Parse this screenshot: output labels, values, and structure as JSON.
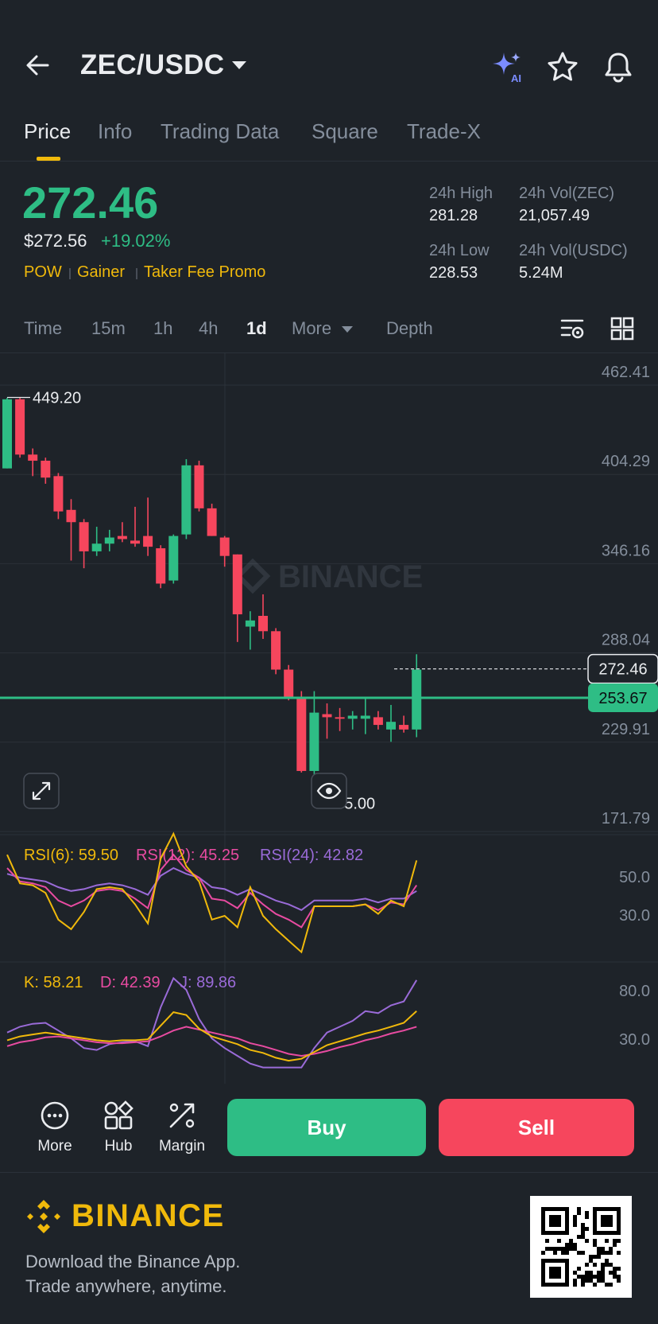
{
  "header": {
    "pair": "ZEC/USDC",
    "icons": [
      "back-arrow-icon",
      "chevron-down-icon",
      "ai-sparkle-icon",
      "star-icon",
      "bell-icon"
    ],
    "ai_label": "AI"
  },
  "tabs": [
    {
      "label": "Price",
      "active": true
    },
    {
      "label": "Info",
      "active": false
    },
    {
      "label": "Trading Data",
      "active": false
    },
    {
      "label": "Square",
      "active": false
    },
    {
      "label": "Trade-X",
      "active": false
    }
  ],
  "price": {
    "last": "272.46",
    "usd": "$272.56",
    "change": "+19.02%",
    "tags": [
      "POW",
      "Gainer",
      "Taker Fee Promo"
    ]
  },
  "stats": [
    {
      "label": "24h High",
      "value": "281.28"
    },
    {
      "label": "24h Vol(ZEC)",
      "value": "21,057.49"
    },
    {
      "label": "24h Low",
      "value": "228.53"
    },
    {
      "label": "24h Vol(USDC)",
      "value": "5.24M"
    }
  ],
  "intervals": [
    {
      "label": "Time",
      "active": false
    },
    {
      "label": "15m",
      "active": false
    },
    {
      "label": "1h",
      "active": false
    },
    {
      "label": "4h",
      "active": false
    },
    {
      "label": "1d",
      "active": true
    },
    {
      "label": "More",
      "active": false
    },
    {
      "label": "Depth",
      "active": false
    }
  ],
  "chart_tools": [
    "chart-settings-icon",
    "grid-layout-icon"
  ],
  "chart_data": {
    "type": "candlestick",
    "y_ticks": [
      "462.41",
      "404.29",
      "346.16",
      "288.04",
      "229.91",
      "171.79"
    ],
    "ylim": [
      171.79,
      462.41
    ],
    "high_marker": "449.20",
    "low_marker": "185.00",
    "last_price_tag": "272.46",
    "line_price_tag": "253.67",
    "line_price": 253.67,
    "watermark": "BINANCE",
    "colors": {
      "up": "#2ebd85",
      "down": "#f6465d"
    },
    "candles": [
      {
        "o": 403,
        "h": 449,
        "l": 403,
        "c": 448
      },
      {
        "o": 448,
        "h": 449,
        "l": 410,
        "c": 412
      },
      {
        "o": 412,
        "h": 416,
        "l": 398,
        "c": 408
      },
      {
        "o": 408,
        "h": 410,
        "l": 393,
        "c": 397
      },
      {
        "o": 398,
        "h": 400,
        "l": 370,
        "c": 375
      },
      {
        "o": 376,
        "h": 383,
        "l": 343,
        "c": 368
      },
      {
        "o": 368,
        "h": 370,
        "l": 338,
        "c": 349
      },
      {
        "o": 349,
        "h": 365,
        "l": 346,
        "c": 354
      },
      {
        "o": 354,
        "h": 363,
        "l": 349,
        "c": 358
      },
      {
        "o": 359,
        "h": 368,
        "l": 355,
        "c": 357
      },
      {
        "o": 356,
        "h": 378,
        "l": 352,
        "c": 354
      },
      {
        "o": 359,
        "h": 384,
        "l": 346,
        "c": 352
      },
      {
        "o": 351,
        "h": 353,
        "l": 325,
        "c": 328
      },
      {
        "o": 330,
        "h": 360,
        "l": 328,
        "c": 359
      },
      {
        "o": 360,
        "h": 409,
        "l": 357,
        "c": 405
      },
      {
        "o": 405,
        "h": 408,
        "l": 375,
        "c": 377
      },
      {
        "o": 377,
        "h": 380,
        "l": 359,
        "c": 359
      },
      {
        "o": 358,
        "h": 359,
        "l": 339,
        "c": 346
      },
      {
        "o": 347,
        "h": 347,
        "l": 290,
        "c": 308
      },
      {
        "o": 300,
        "h": 310,
        "l": 285,
        "c": 304
      },
      {
        "o": 307,
        "h": 321,
        "l": 292,
        "c": 297
      },
      {
        "o": 297,
        "h": 299,
        "l": 269,
        "c": 272
      },
      {
        "o": 272,
        "h": 275,
        "l": 252,
        "c": 254
      },
      {
        "o": 253,
        "h": 258,
        "l": 205,
        "c": 206
      },
      {
        "o": 206,
        "h": 258,
        "l": 185,
        "c": 244
      },
      {
        "o": 243,
        "h": 250,
        "l": 227,
        "c": 241
      },
      {
        "o": 241,
        "h": 247,
        "l": 232,
        "c": 240
      },
      {
        "o": 240,
        "h": 245,
        "l": 233,
        "c": 242
      },
      {
        "o": 240,
        "h": 253,
        "l": 230,
        "c": 242
      },
      {
        "o": 241,
        "h": 245,
        "l": 233,
        "c": 236
      },
      {
        "o": 233,
        "h": 249,
        "l": 225,
        "c": 238
      },
      {
        "o": 236,
        "h": 242,
        "l": 231,
        "c": 233
      },
      {
        "o": 233,
        "h": 282,
        "l": 228,
        "c": 272
      }
    ]
  },
  "rsi": {
    "labels": [
      "RSI(6): 59.50",
      "RSI(12): 45.25",
      "RSI(24): 42.82"
    ],
    "colors": [
      "#f0b90b",
      "#e84ba1",
      "#9a6bd8"
    ],
    "ticks": [
      "50.0",
      "30.0"
    ],
    "rsi6": [
      62,
      47,
      46,
      42,
      28,
      23,
      32,
      44,
      45,
      44,
      36,
      26,
      60,
      73,
      56,
      48,
      28,
      30,
      24,
      45,
      30,
      23,
      17,
      11,
      35,
      35,
      35,
      35,
      36,
      31,
      38,
      35,
      59
    ],
    "rsi12": [
      55,
      48,
      47,
      45,
      38,
      35,
      38,
      43,
      44,
      43,
      39,
      34,
      54,
      62,
      54,
      50,
      39,
      38,
      34,
      42,
      36,
      31,
      28,
      24,
      35,
      35,
      35,
      35,
      36,
      33,
      37,
      36,
      46
    ],
    "rsi24": [
      52,
      50,
      49,
      48,
      45,
      43,
      44,
      46,
      47,
      46,
      44,
      41,
      51,
      55,
      52,
      50,
      45,
      44,
      41,
      44,
      41,
      38,
      36,
      33,
      38,
      38,
      38,
      38,
      39,
      37,
      39,
      39,
      43
    ]
  },
  "kdj": {
    "labels": [
      "K: 58.21",
      "D: 42.39",
      "J: 89.86"
    ],
    "colors": [
      "#f0b90b",
      "#e84ba1",
      "#9a6bd8"
    ],
    "ticks": [
      "80.0",
      "30.0"
    ],
    "k": [
      28,
      32,
      34,
      36,
      34,
      32,
      30,
      28,
      27,
      28,
      28,
      29,
      43,
      57,
      54,
      40,
      32,
      28,
      24,
      18,
      15,
      10,
      7,
      9,
      16,
      23,
      27,
      31,
      35,
      38,
      42,
      46,
      58
    ],
    "d": [
      22,
      26,
      28,
      31,
      32,
      30,
      28,
      26,
      25,
      25,
      26,
      27,
      32,
      38,
      42,
      39,
      36,
      33,
      30,
      25,
      22,
      18,
      14,
      12,
      14,
      17,
      21,
      24,
      28,
      31,
      35,
      38,
      42
    ],
    "j": [
      36,
      42,
      45,
      46,
      38,
      30,
      20,
      18,
      24,
      26,
      27,
      22,
      62,
      92,
      80,
      50,
      30,
      20,
      12,
      4,
      0,
      0,
      0,
      0,
      20,
      36,
      42,
      48,
      58,
      56,
      64,
      68,
      90
    ]
  },
  "actions": [
    {
      "label": "More",
      "icon": "more-dots-icon"
    },
    {
      "label": "Hub",
      "icon": "hub-icon"
    },
    {
      "label": "Margin",
      "icon": "margin-icon"
    }
  ],
  "buttons": {
    "buy": "Buy",
    "sell": "Sell",
    "buy_color": "#2ebd85",
    "sell_color": "#f6465d"
  },
  "footer": {
    "brand": "BINANCE",
    "line1": "Download the Binance App.",
    "line2": "Trade anywhere, anytime.",
    "icons": [
      "binance-logo-icon",
      "qr-code-icon"
    ]
  }
}
